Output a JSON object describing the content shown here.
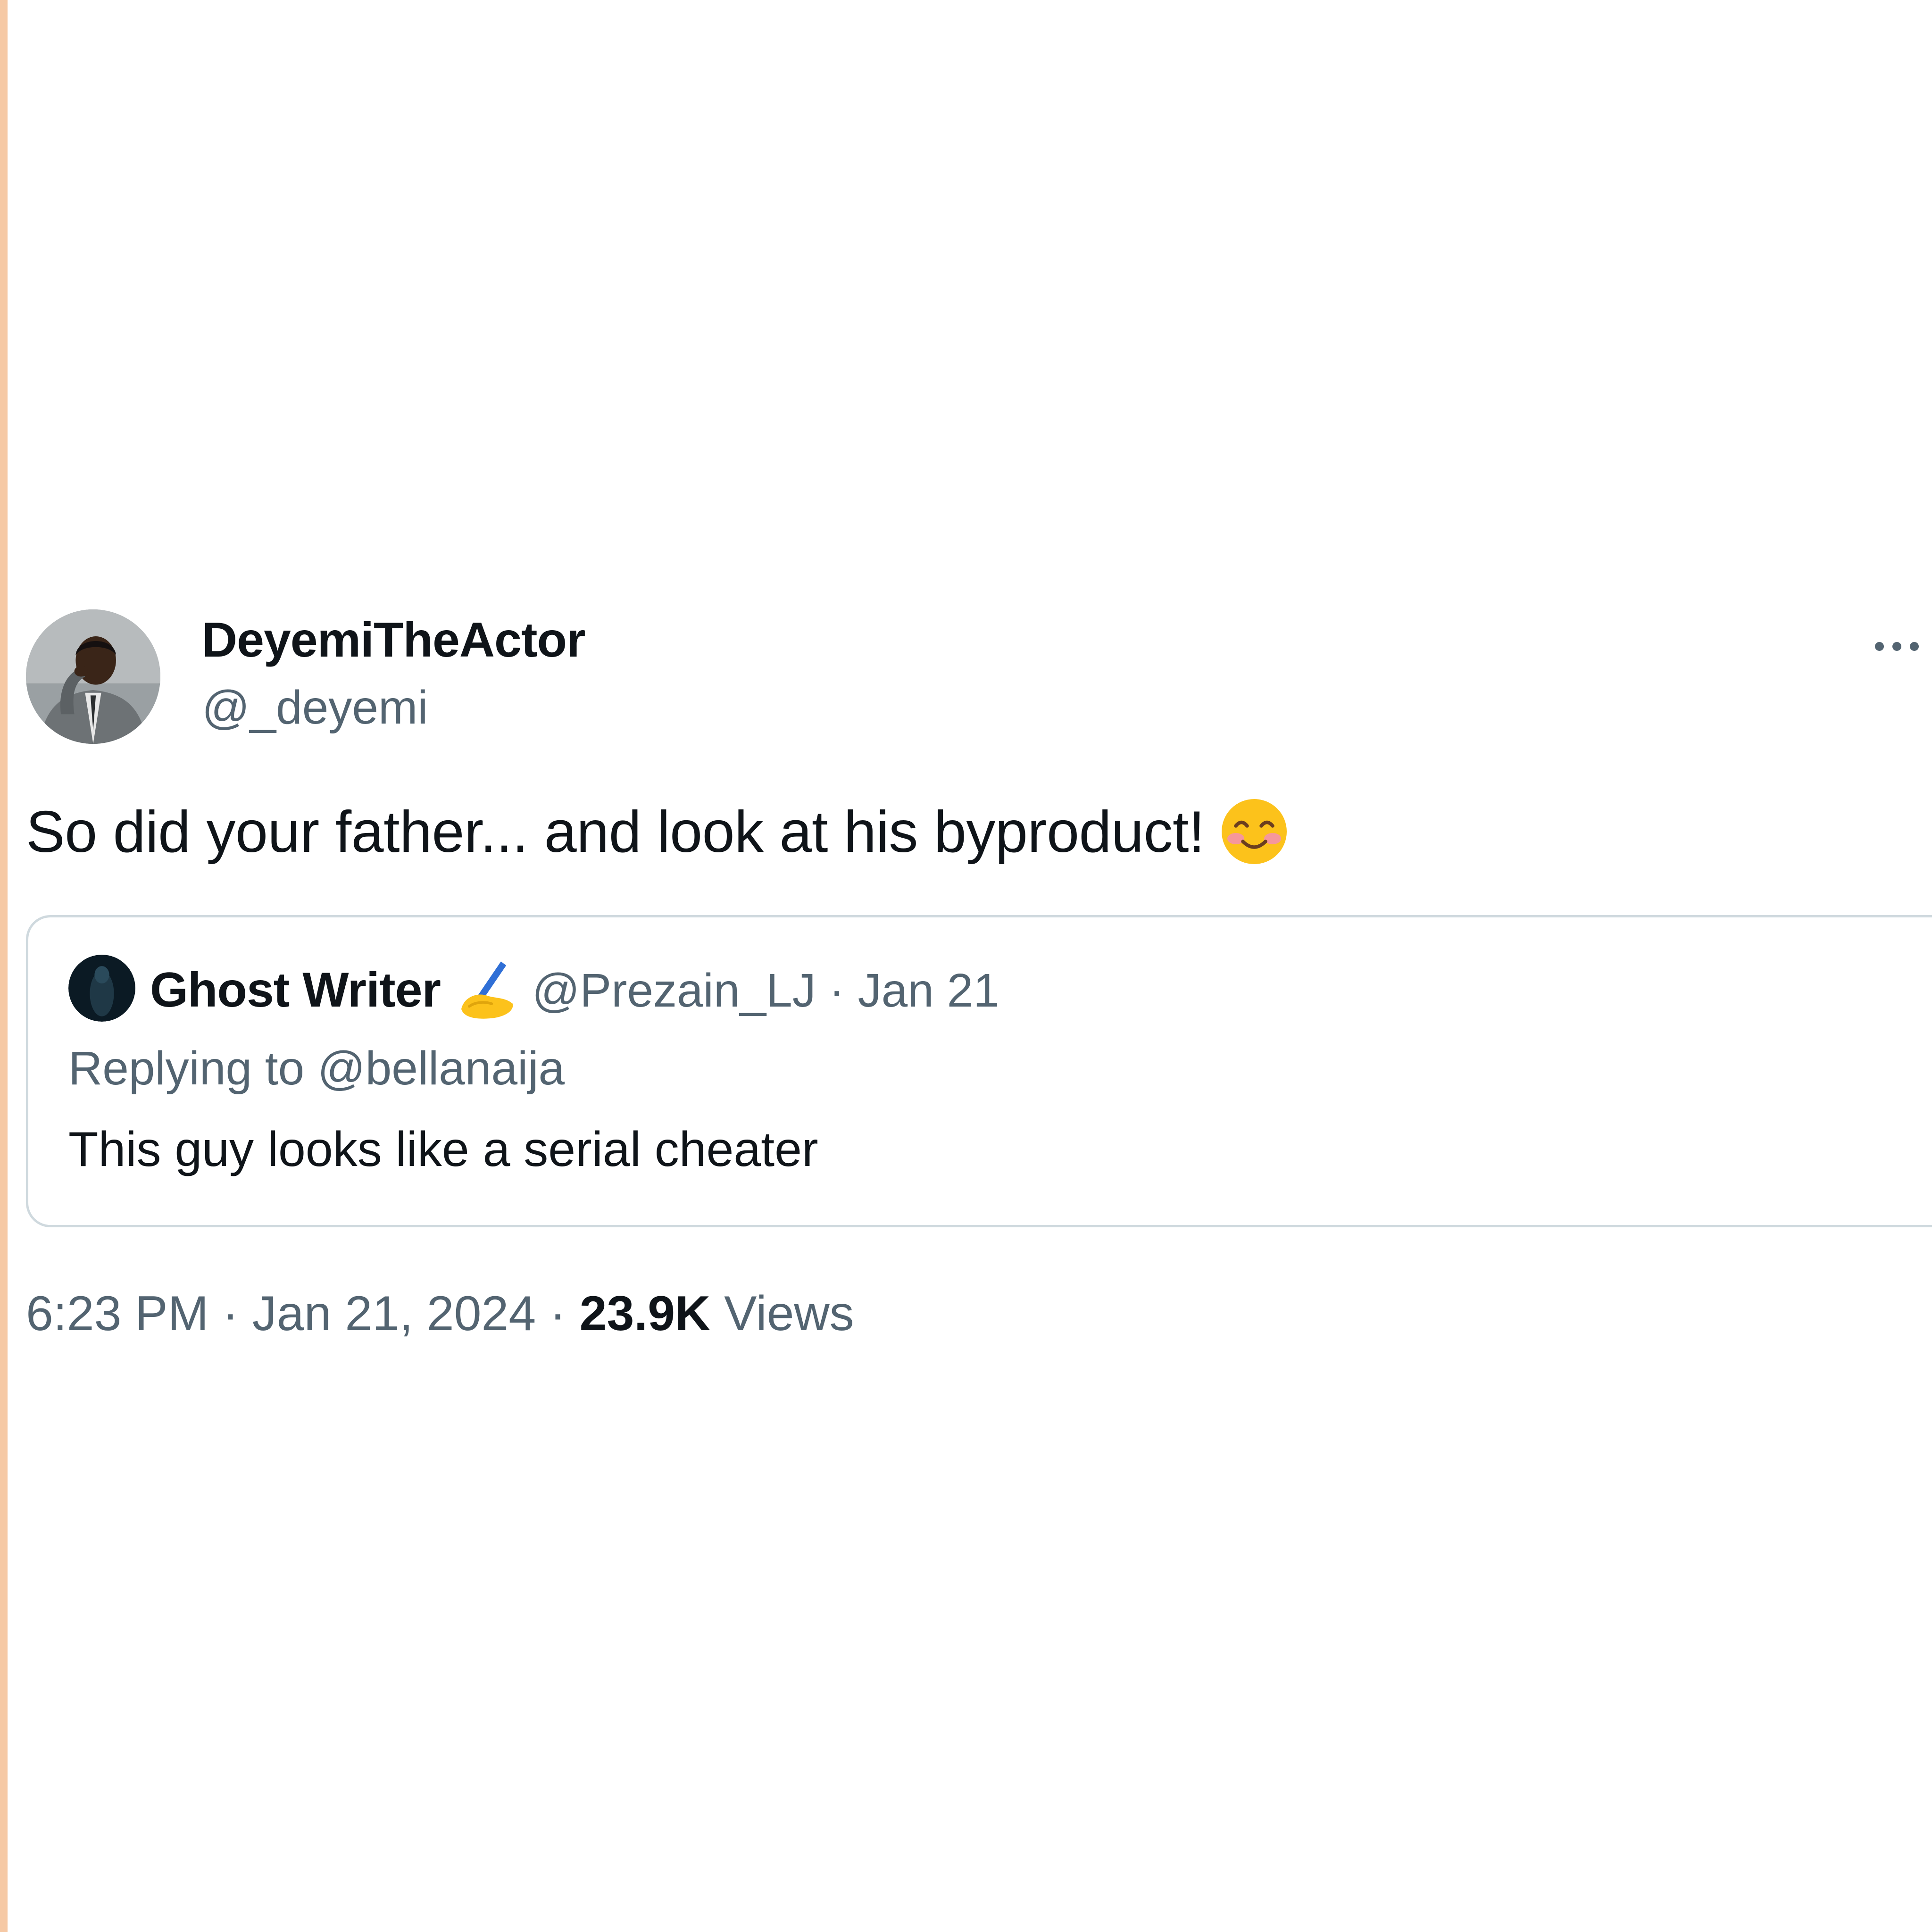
{
  "author": {
    "display_name": "DeyemiTheActor",
    "handle": "@_deyemi"
  },
  "tweet": {
    "text": "So did your father... and look at his byproduct!",
    "emoji": "smiling-face-with-blushing-cheeks"
  },
  "quoted_tweet": {
    "display_name": "Ghost Writer",
    "name_icon": "writing-hand-emoji",
    "handle": "@Prezain_LJ",
    "separator": "·",
    "date": "Jan 21",
    "replying_prefix": "Replying to",
    "replying_to": "@bellanaija",
    "text": "This guy looks like a serial cheater"
  },
  "footer": {
    "time": "6:23 PM",
    "separator": "·",
    "date": "Jan 21, 2024",
    "views_count": "23.9K",
    "views_label": "Views"
  },
  "colors": {
    "text_primary": "#0f1419",
    "text_secondary": "#536471",
    "border": "#cfd9de",
    "edge_strip": "#f6c9a5"
  }
}
